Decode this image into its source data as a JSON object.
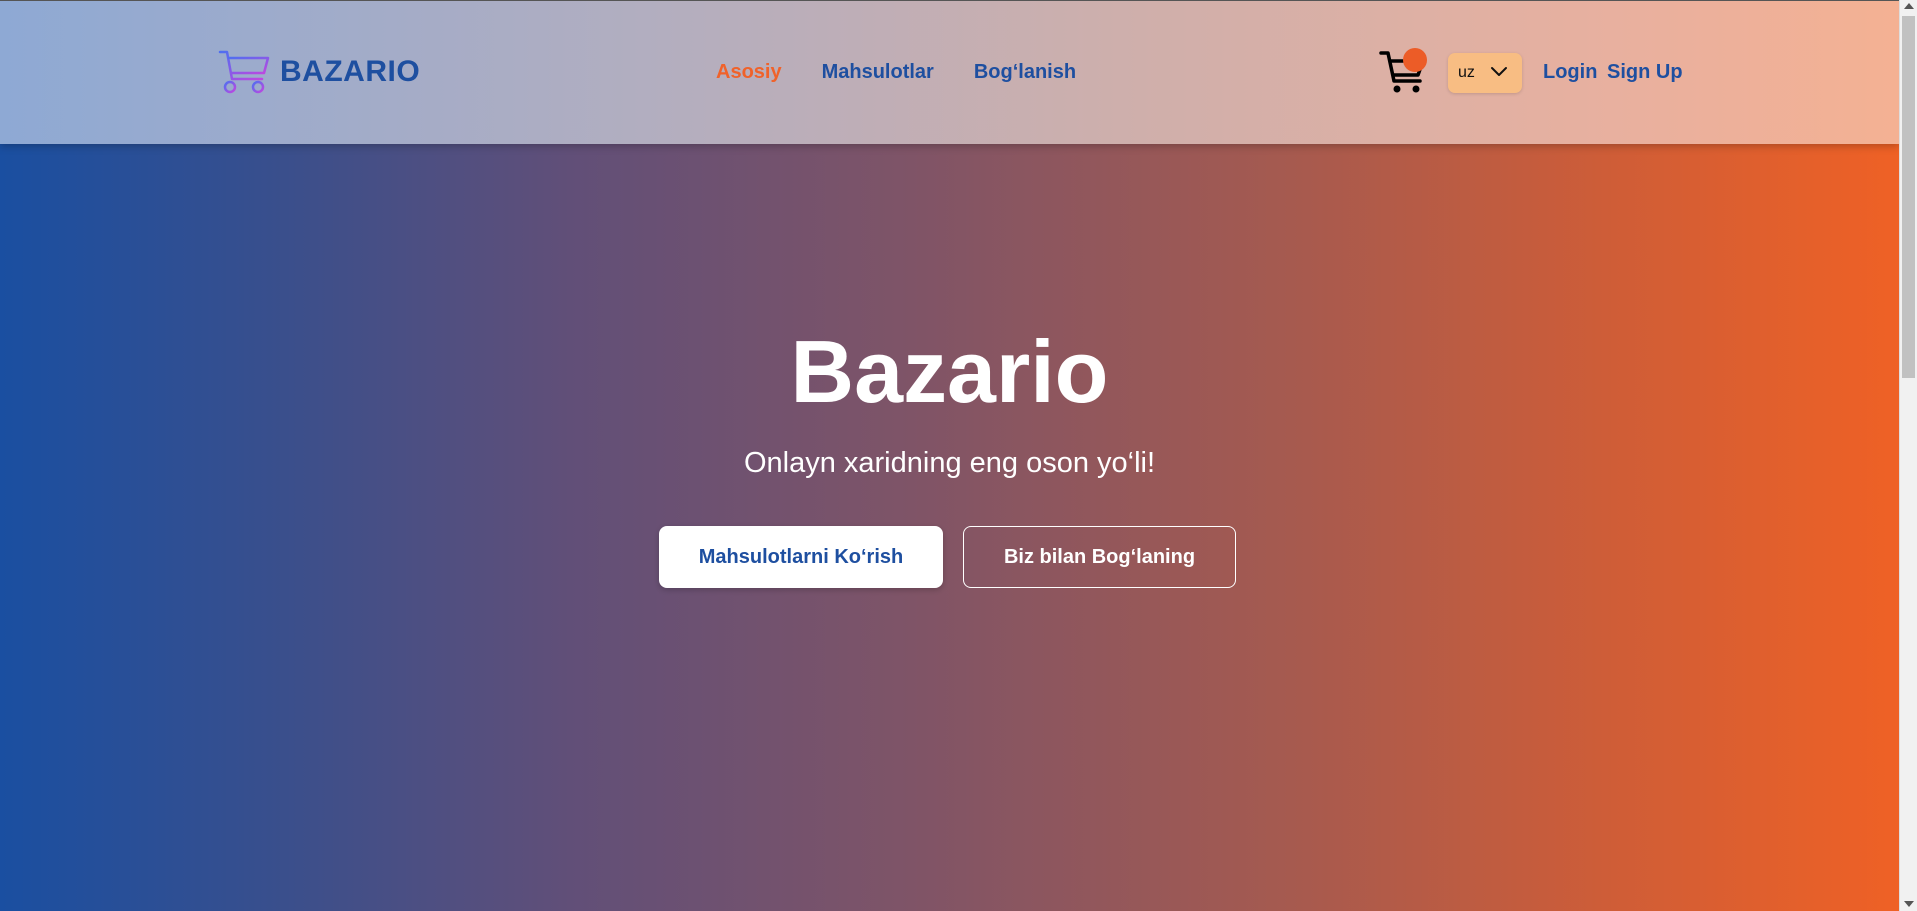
{
  "brand": {
    "name": "BAZARIO",
    "logo_icon": "shopping-cart-icon"
  },
  "nav": {
    "links": [
      {
        "label": "Asosiy",
        "active": true
      },
      {
        "label": "Mahsulotlar",
        "active": false
      },
      {
        "label": "Bog‘lanish",
        "active": false
      }
    ]
  },
  "cart": {
    "icon": "cart-icon"
  },
  "language": {
    "selected": "uz",
    "icon": "chevron-down-icon"
  },
  "auth": {
    "login_label": "Login",
    "signup_label": "Sign Up"
  },
  "hero": {
    "title": "Bazario",
    "subtitle": "Onlayn xaridning eng oson yo‘li!",
    "primary_button": "Mahsulotlarni Ko‘rish",
    "secondary_button": "Biz bilan Bog‘laning"
  },
  "colors": {
    "primary_blue": "#1e4fa0",
    "accent_orange": "#f0622a",
    "gradient_start": "#1a4fa1",
    "gradient_end": "#ef6125",
    "lang_button": "#f8bd83"
  }
}
